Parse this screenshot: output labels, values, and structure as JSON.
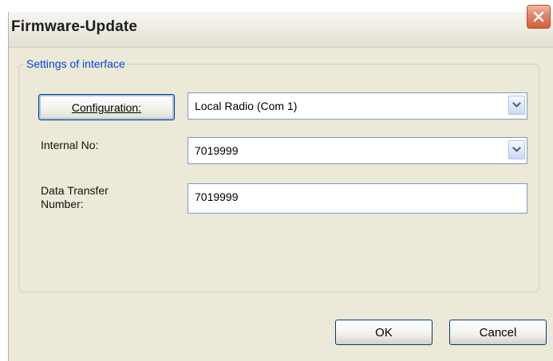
{
  "window": {
    "title": "Firmware-Update",
    "close_icon": "close-icon"
  },
  "group": {
    "legend": "Settings of interface"
  },
  "configuration": {
    "button_label": "Configuration:",
    "value": "Local Radio (Com 1)"
  },
  "internal_no": {
    "label": "Internal No:",
    "value": "7019999"
  },
  "data_transfer": {
    "label": "Data Transfer Number:",
    "value": "7019999"
  },
  "buttons": {
    "ok": "OK",
    "cancel": "Cancel"
  },
  "colors": {
    "legend_text": "#0046d5",
    "dialog_background": "#ece9d8",
    "close_button": "#e08465"
  }
}
